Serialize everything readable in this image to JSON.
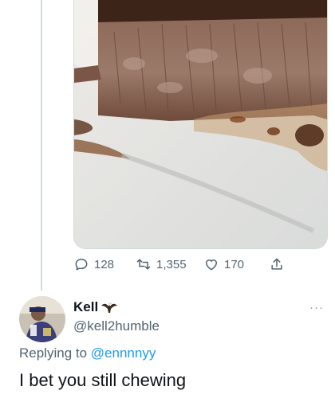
{
  "previous_tweet": {
    "media_description": "steak-photo",
    "actions": {
      "reply_count": "128",
      "retweet_count": "1,355",
      "like_count": "170"
    }
  },
  "reply": {
    "display_name": "Kell",
    "handle": "@kell2humble",
    "replying_to_label": "Replying to",
    "replying_to_handle": "@ennnnyy",
    "text": "I bet you still chewing",
    "more_label": "···"
  },
  "colors": {
    "accent": "#1d9bf0",
    "secondary_text": "#536471",
    "divider": "#cfd9de"
  }
}
